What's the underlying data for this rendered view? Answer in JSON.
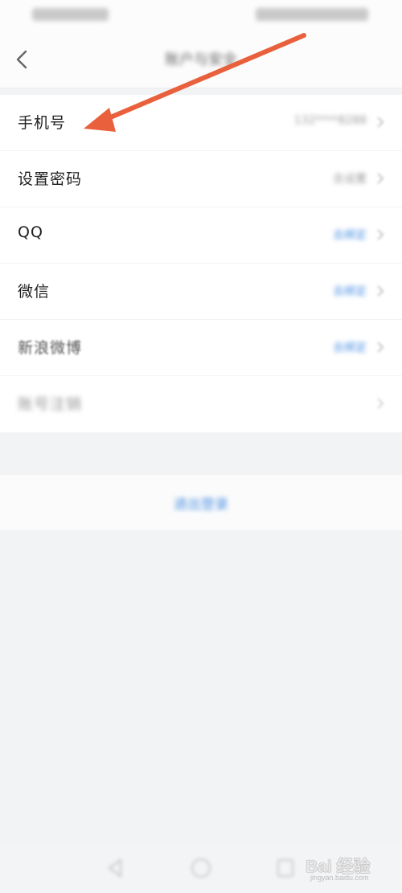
{
  "nav": {
    "title": "账户与安全"
  },
  "rows": [
    {
      "label": "手机号",
      "value": "132****8288"
    },
    {
      "label": "设置密码",
      "value": "去设置"
    },
    {
      "label": "QQ",
      "value": "去绑定"
    },
    {
      "label": "微信",
      "value": "去绑定"
    },
    {
      "label": "新浪微博",
      "value": "去绑定"
    },
    {
      "label": "账号注销",
      "value": ""
    }
  ],
  "logout": {
    "label": "退出登录"
  },
  "watermark": {
    "brand": "Bai 经验",
    "url": "jingyan.baidu.com"
  },
  "colors": {
    "accent": "#4a90e2",
    "annotation_arrow": "#e8603c",
    "background": "#f1f3f5"
  },
  "icons": {
    "back": "chevron-left-icon",
    "row_arrow": "chevron-right-icon"
  }
}
